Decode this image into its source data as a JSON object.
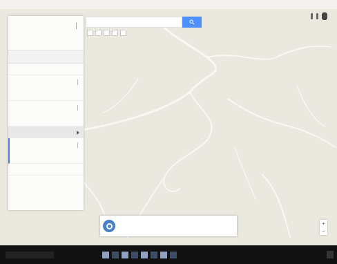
{
  "sidebar": {
    "title": "",
    "subtitle": "",
    "section": "",
    "rows": [
      {
        "name": "",
        "link": "",
        "sub": ""
      },
      {
        "name": "",
        "link": "",
        "sub": ""
      },
      {
        "name": "",
        "link": "",
        "sub": ""
      }
    ],
    "bottom_label": ""
  },
  "search": {
    "placeholder": "",
    "button_icon": "search-icon"
  },
  "map": {
    "labels": [
      "",
      ""
    ]
  },
  "notice": {
    "title": "",
    "description": "",
    "link": ""
  },
  "taskbar": {
    "clock": ""
  },
  "zoom": {
    "in": "+",
    "out": "−"
  },
  "colors": {
    "accent": "#4d90fe",
    "link": "#4a7fd4",
    "taskbar": "#121212",
    "map_bg": "#ebe8e0"
  }
}
